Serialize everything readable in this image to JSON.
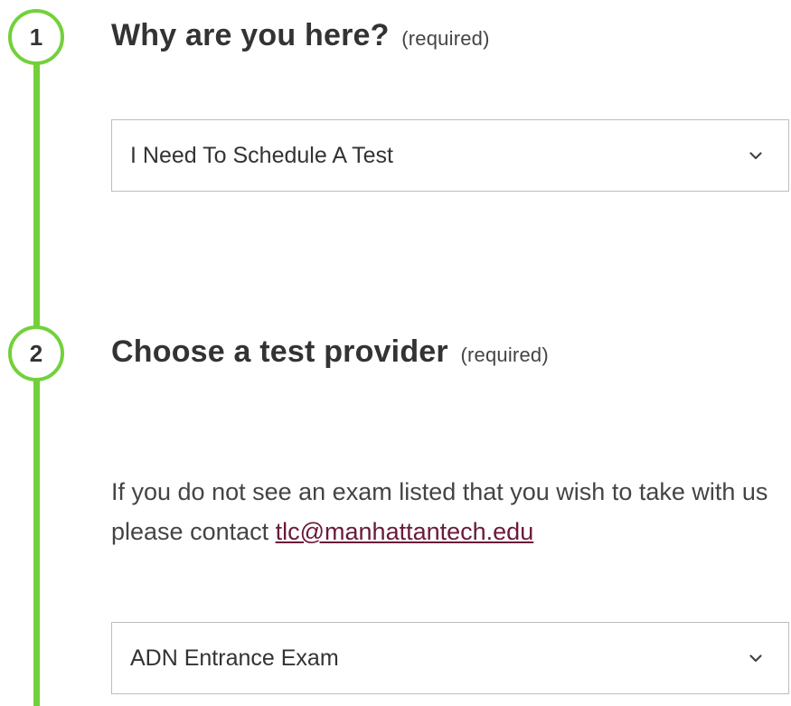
{
  "steps": [
    {
      "number": "1",
      "title": "Why are you here?",
      "required_label": "(required)",
      "select_value": "I Need To Schedule A Test"
    },
    {
      "number": "2",
      "title": "Choose a test provider",
      "required_label": "(required)",
      "info_text": "If you do not see an exam listed that you wish to take with us please contact ",
      "contact_email": "tlc@manhattantech.edu",
      "select_value": "ADN Entrance Exam"
    }
  ],
  "colors": {
    "accent_green": "#72d13a",
    "link": "#6a1a3a",
    "text": "#333333",
    "border": "#bdbdbd"
  },
  "icons": {
    "select_caret": "chevron-down-icon"
  }
}
